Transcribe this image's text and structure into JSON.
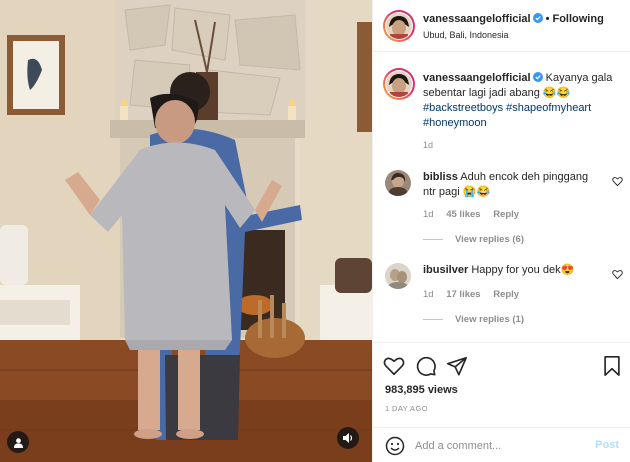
{
  "post": {
    "username": "vanessaangelofficial",
    "follow_separator": "•",
    "follow_status": "Following",
    "location": "Ubud, Bali, Indonesia"
  },
  "caption": {
    "username": "vanessaangelofficial",
    "text": "Kayanya gala sebentar lagi jadi abang 😂😂",
    "hashtags": "#backstreetboys #shapeofmyheart #honeymoon",
    "time": "1d"
  },
  "comments": [
    {
      "username": "bibliss",
      "text": "Aduh encok deh pinggang ntr pagi 😭😂",
      "time": "1d",
      "likes": "45 likes",
      "reply": "Reply",
      "view_replies": "View replies (6)"
    },
    {
      "username": "ibusilver",
      "text": "Happy for you dek😍",
      "time": "1d",
      "likes": "17 likes",
      "reply": "Reply",
      "view_replies": "View replies (1)"
    }
  ],
  "stats": {
    "views": "983,895 views",
    "date": "1 DAY AGO"
  },
  "add_comment": {
    "placeholder": "Add a comment...",
    "post_label": "Post"
  },
  "icons": {
    "like": "heart-icon",
    "comment": "comment-icon",
    "share": "share-icon",
    "save": "bookmark-icon",
    "emoji": "emoji-icon",
    "verified": "verified-badge-icon",
    "user_tag": "user-tag-icon",
    "audio": "speaker-icon"
  },
  "colors": {
    "text": "#262626",
    "secondary": "#8e8e8e",
    "hashtag": "#00376b",
    "post_disabled": "#b2dffc",
    "verified": "#3897f0"
  }
}
